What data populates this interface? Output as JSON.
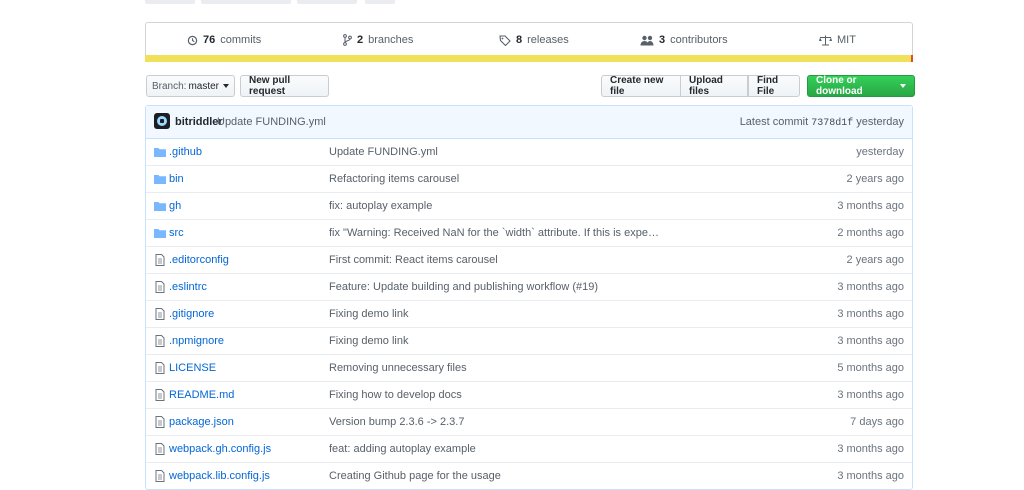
{
  "summary": {
    "commits": {
      "count": "76",
      "label": "commits"
    },
    "branches": {
      "count": "2",
      "label": "branches"
    },
    "releases": {
      "count": "8",
      "label": "releases"
    },
    "contributors": {
      "count": "3",
      "label": "contributors"
    },
    "license": "MIT"
  },
  "colors": {
    "language_main": "#f1e05a",
    "language_secondary": "#e34c26",
    "green": "#28a745",
    "link": "#0366d6"
  },
  "toolbar": {
    "branch_prefix": "Branch:",
    "branch_name": "master",
    "new_pull_request": "New pull request",
    "create_new_file": "Create new file",
    "upload_files": "Upload files",
    "find_file": "Find File",
    "clone_or_download": "Clone or download"
  },
  "latest_commit": {
    "author": "bitriddler",
    "message": "Update FUNDING.yml",
    "label": "Latest commit",
    "sha": "7378d1f",
    "time": "yesterday"
  },
  "files": [
    {
      "type": "folder",
      "name": ".github",
      "message": "Update FUNDING.yml",
      "age": "yesterday"
    },
    {
      "type": "folder",
      "name": "bin",
      "message": "Refactoring items carousel",
      "age": "2 years ago"
    },
    {
      "type": "folder",
      "name": "gh",
      "message": "fix: autoplay example",
      "age": "3 months ago"
    },
    {
      "type": "folder",
      "name": "src",
      "message": "fix \"Warning: Received NaN for the `width` attribute. If this is expe…",
      "age": "2 months ago"
    },
    {
      "type": "file",
      "name": ".editorconfig",
      "message": "First commit: React items carousel",
      "age": "2 years ago"
    },
    {
      "type": "file",
      "name": ".eslintrc",
      "message": "Feature: Update building and publishing workflow (#19)",
      "age": "3 months ago"
    },
    {
      "type": "file",
      "name": ".gitignore",
      "message": "Fixing demo link",
      "age": "3 months ago"
    },
    {
      "type": "file",
      "name": ".npmignore",
      "message": "Fixing demo link",
      "age": "3 months ago"
    },
    {
      "type": "file",
      "name": "LICENSE",
      "message": "Removing unnecessary files",
      "age": "5 months ago"
    },
    {
      "type": "file",
      "name": "README.md",
      "message": "Fixing how to develop docs",
      "age": "3 months ago"
    },
    {
      "type": "file",
      "name": "package.json",
      "message": "Version bump 2.3.6 -> 2.3.7",
      "age": "7 days ago"
    },
    {
      "type": "file",
      "name": "webpack.gh.config.js",
      "message": "feat: adding autoplay example",
      "age": "3 months ago"
    },
    {
      "type": "file",
      "name": "webpack.lib.config.js",
      "message": "Creating Github page for the usage",
      "age": "3 months ago"
    }
  ]
}
